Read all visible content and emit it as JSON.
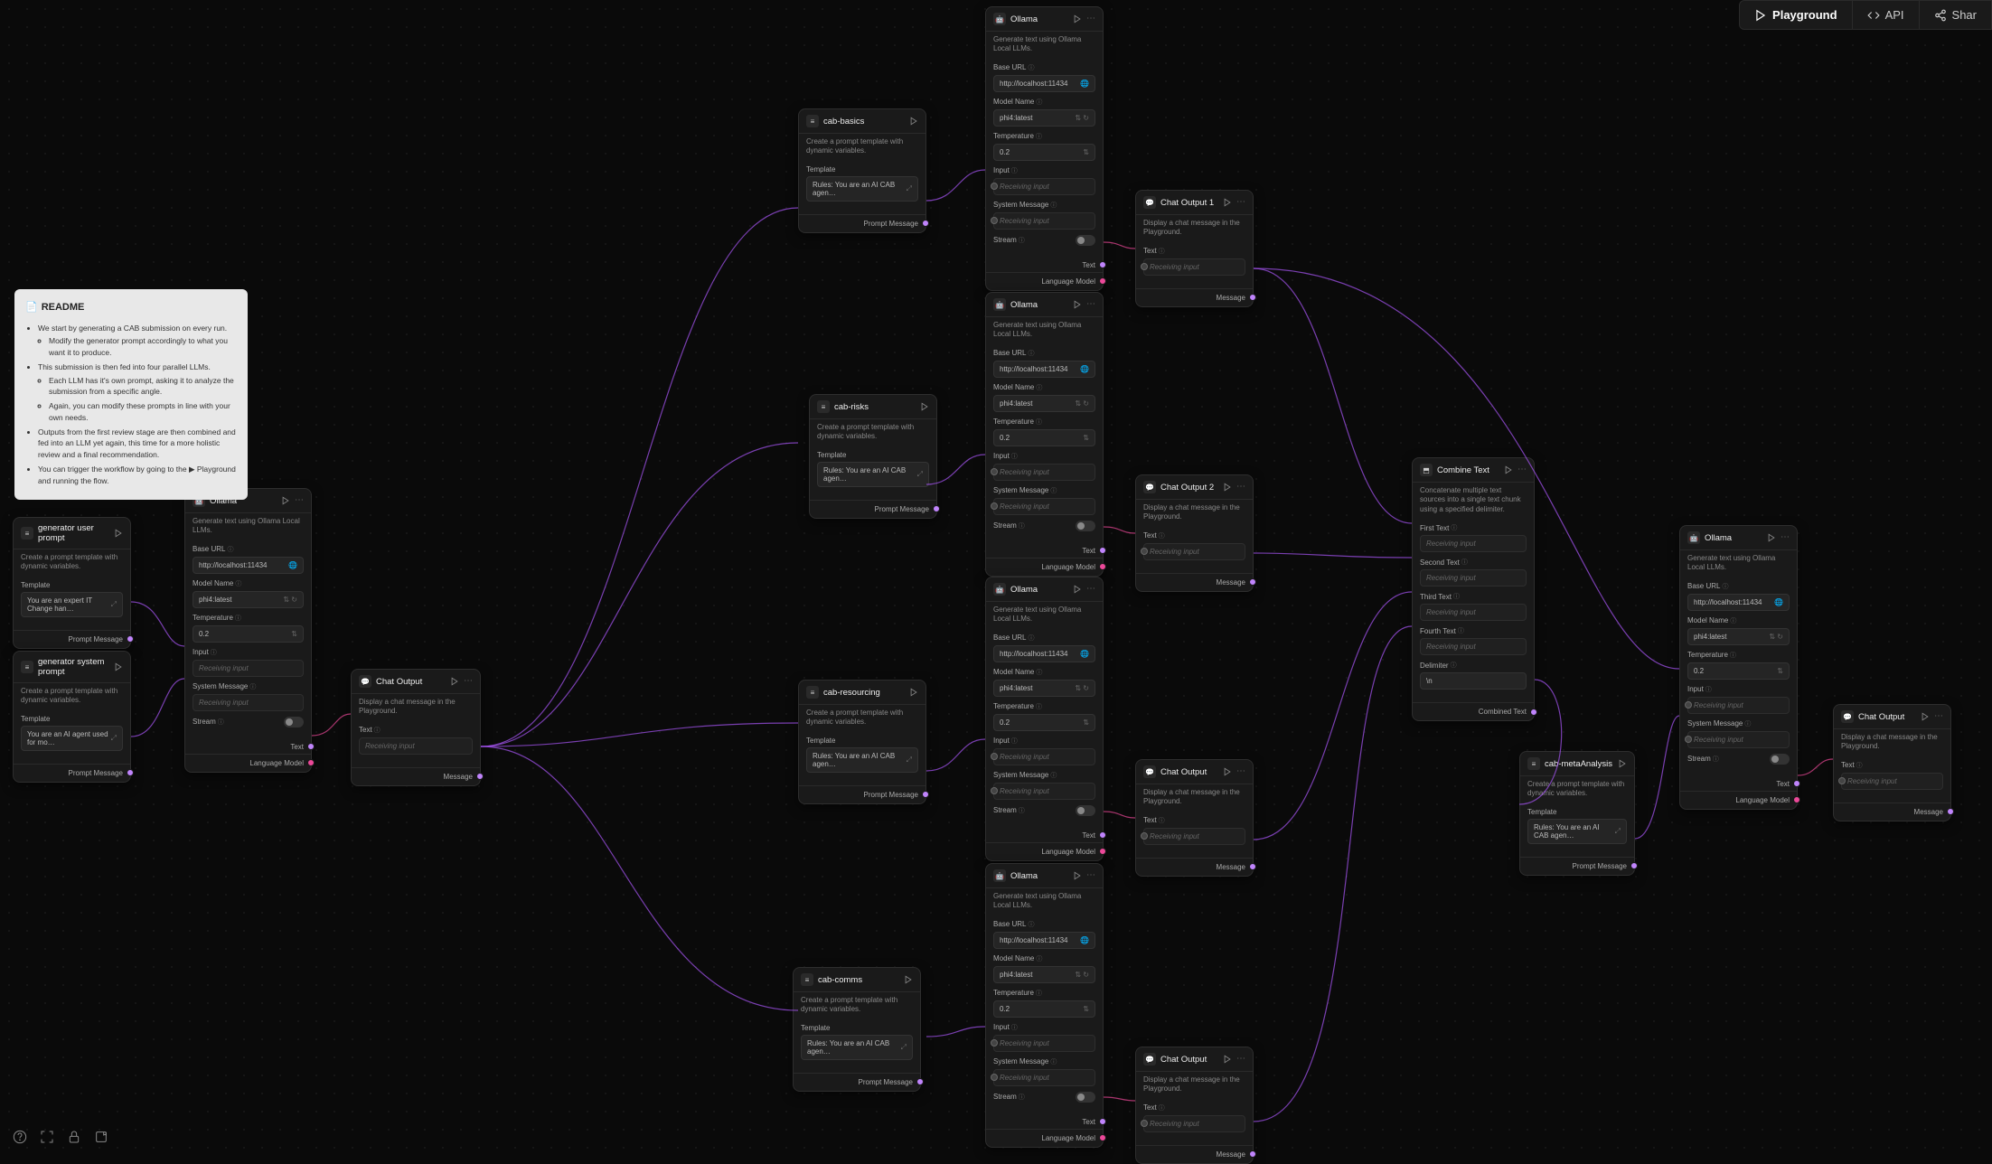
{
  "toolbar": {
    "playground": "Playground",
    "api": "API",
    "share": "Shar"
  },
  "readme": {
    "title": "README",
    "items": [
      "We start by generating a CAB submission on every run.",
      [
        "Modify the generator prompt accordingly to what you want it to produce."
      ],
      "This submission is then fed into four parallel LLMs.",
      [
        "Each LLM has it's own prompt, asking it to analyze the submission from a specific angle.",
        "Again, you can modify these prompts in line with your own needs."
      ],
      "Outputs from the first review stage are then combined and fed into an LLM yet again, this time for a more holistic review and a final recommendation.",
      "You can trigger the workflow by going to the ▶ Playground and running the flow."
    ]
  },
  "common": {
    "desc_prompt": "Create a prompt template with dynamic variables.",
    "desc_ollama": "Generate text using Ollama Local LLMs.",
    "desc_chat": "Display a chat message in the Playground.",
    "desc_combine": "Concatenate multiple text sources into a single text chunk using a specified delimiter.",
    "template_label": "Template",
    "baseurl_label": "Base URL",
    "baseurl_value": "http://localhost:11434",
    "modelname_label": "Model Name",
    "modelname_value": "phi4:latest",
    "temp_label": "Temperature",
    "temp_value": "0.2",
    "input_label": "Input",
    "sysmsg_label": "System Message",
    "stream_label": "Stream",
    "text_label": "Text",
    "receiving": "Receiving input",
    "prompt_out": "Prompt Message",
    "langmodel_out": "Language Model",
    "message_out": "Message",
    "combined_out": "Combined Text",
    "first": "First Text",
    "second": "Second Text",
    "third": "Third Text",
    "fourth": "Fourth Text",
    "delimiter_label": "Delimiter",
    "delimiter_value": "\\n"
  },
  "nodes": {
    "genUser": {
      "title": "generator user prompt",
      "template": "You are an expert IT Change han…"
    },
    "genSys": {
      "title": "generator system prompt",
      "template": "You are an AI agent used for mo…"
    },
    "ollamaGen": {
      "title": "Ollama"
    },
    "chatOutMain": {
      "title": "Chat Output"
    },
    "cabBasics": {
      "title": "cab-basics",
      "template": "Rules: You are an AI CAB agen…"
    },
    "cabRisks": {
      "title": "cab-risks",
      "template": "Rules: You are an AI CAB agen…"
    },
    "cabResourcing": {
      "title": "cab-resourcing",
      "template": "Rules: You are an AI CAB agen…"
    },
    "cabComms": {
      "title": "cab-comms",
      "template": "Rules: You are an AI CAB agen…"
    },
    "ollama1": {
      "title": "Ollama"
    },
    "ollama2": {
      "title": "Ollama"
    },
    "ollama3": {
      "title": "Ollama"
    },
    "ollama4": {
      "title": "Ollama"
    },
    "chat1": {
      "title": "Chat Output 1"
    },
    "chat2": {
      "title": "Chat Output 2"
    },
    "chat3": {
      "title": "Chat Output"
    },
    "chat4": {
      "title": "Chat Output"
    },
    "combine": {
      "title": "Combine Text"
    },
    "cabMeta": {
      "title": "cab-metaAnalysis",
      "template": "Rules: You are an AI CAB agen…"
    },
    "ollamaFinal": {
      "title": "Ollama"
    },
    "chatFinal": {
      "title": "Chat Output"
    }
  }
}
